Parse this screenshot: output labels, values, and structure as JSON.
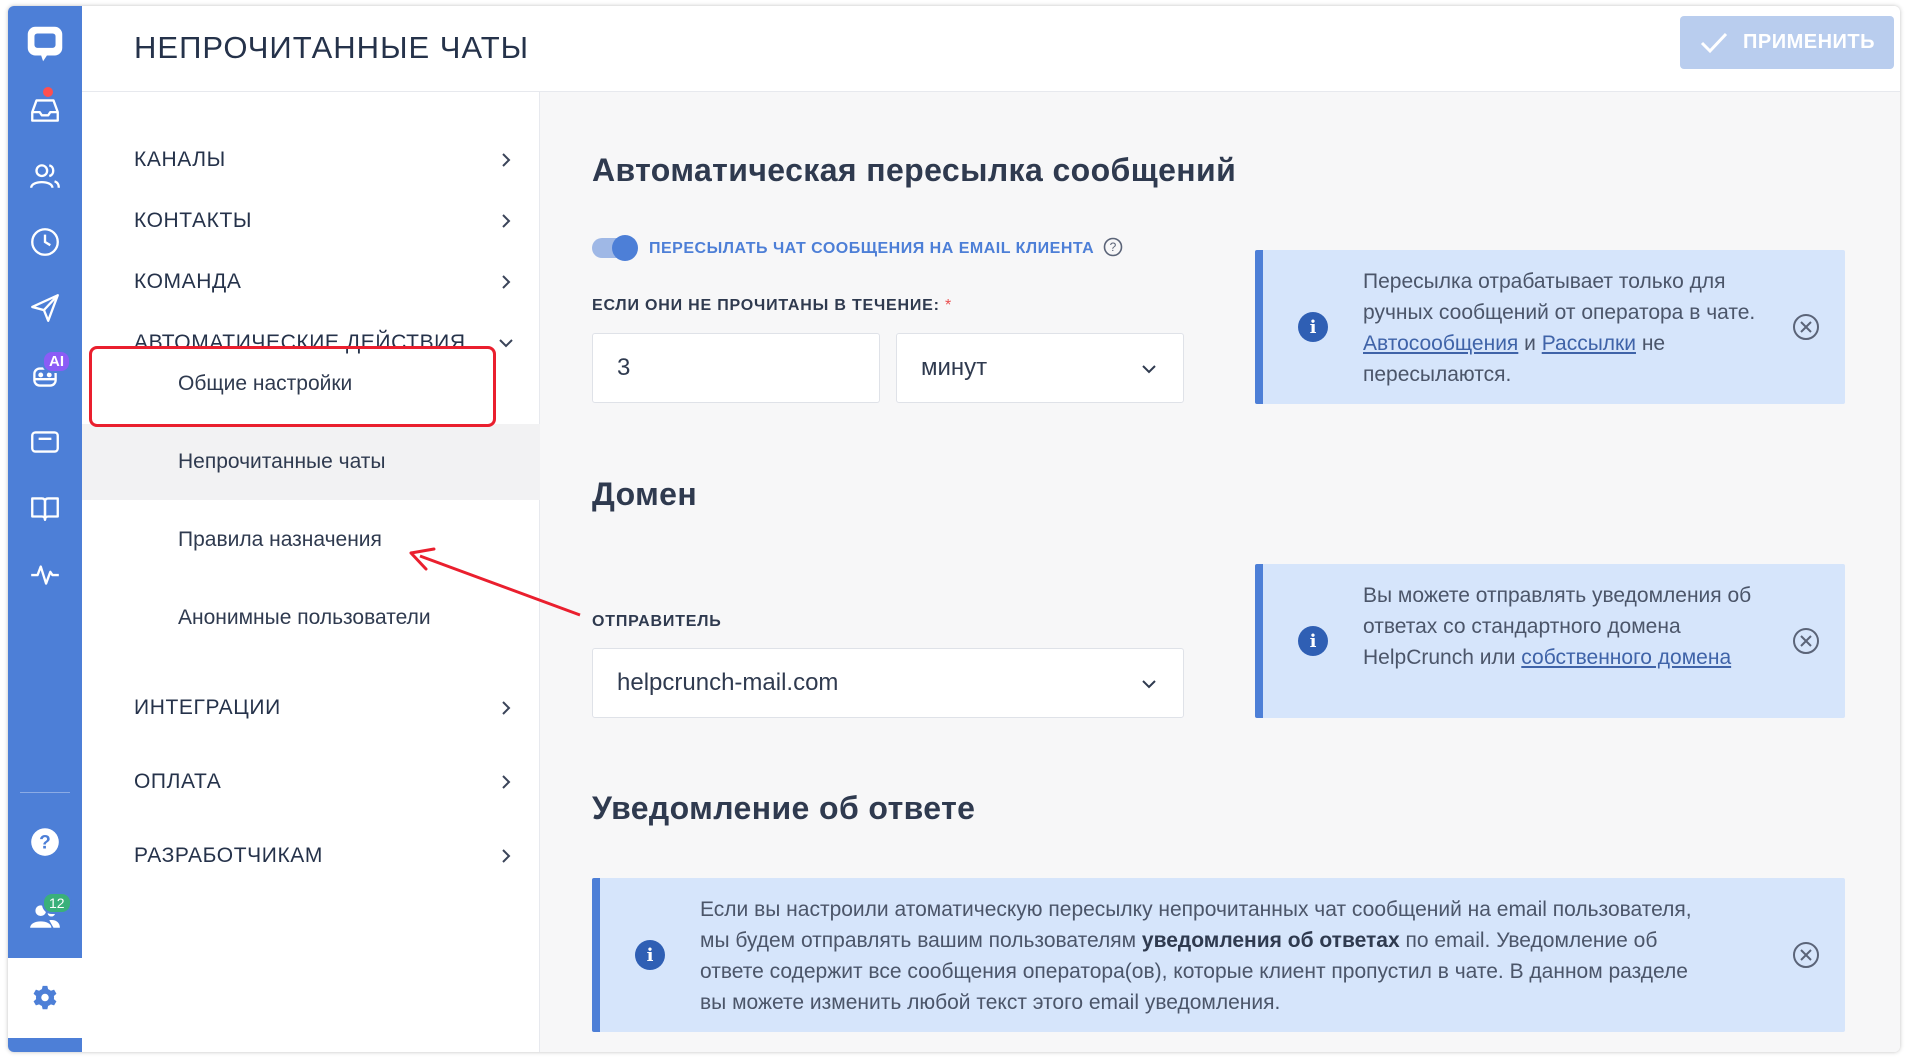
{
  "app": {
    "rail": {
      "items": [
        {
          "icon": "chat-logo-icon"
        },
        {
          "icon": "inbox-icon",
          "has_dot": true
        },
        {
          "icon": "contacts-icon"
        },
        {
          "icon": "clock-icon"
        },
        {
          "icon": "send-icon"
        },
        {
          "icon": "ai-bot-icon",
          "badge": "AI"
        },
        {
          "icon": "widget-icon"
        },
        {
          "icon": "knowledge-base-icon"
        },
        {
          "icon": "activity-icon"
        },
        {
          "icon": "help-icon"
        },
        {
          "icon": "team-icon",
          "badge": "12"
        },
        {
          "icon": "settings-icon",
          "active": true
        }
      ]
    },
    "colors": {
      "rail": "#4d7fd7",
      "accent": "#4d7fd7",
      "annotation": "#ea1f2e",
      "info_bg": "#d6e5fb"
    }
  },
  "header": {
    "title": "НЕПРОЧИТАННЫЕ ЧАТЫ",
    "apply_label": "ПРИМЕНИТЬ"
  },
  "nav": {
    "items": [
      {
        "label": "КАНАЛЫ"
      },
      {
        "label": "КОНТАКТЫ"
      },
      {
        "label": "КОМАНДА"
      },
      {
        "label": "АВТОМАТИЧЕСКИЕ ДЕЙСТВИЯ",
        "expanded": true
      },
      {
        "label": "ИНТЕГРАЦИИ"
      },
      {
        "label": "ОПЛАТА"
      },
      {
        "label": "РАЗРАБОТЧИКАМ"
      }
    ],
    "sub_items": [
      {
        "label": "Общие настройки"
      },
      {
        "label": "Непрочитанные чаты",
        "selected": true
      },
      {
        "label": "Правила назначения"
      },
      {
        "label": "Анонимные пользователи"
      }
    ]
  },
  "forwarding": {
    "title": "Автоматическая пересылка сообщений",
    "toggle_label": "ПЕРЕСЫЛАТЬ ЧАТ СООБЩЕНИЯ НА EMAIL КЛИЕНТА",
    "toggle_on": true,
    "delay_label": "ЕСЛИ ОНИ НЕ ПРОЧИТАНЫ В ТЕЧЕНИЕ:",
    "required_mark": "*",
    "delay_value": "3",
    "delay_unit": "минут",
    "info": {
      "part1": "Пересылка отрабатывает только для ручных сообщений от оператора в чате. ",
      "link1": "Автосообщения",
      "part2": " и ",
      "link2": "Рассылки",
      "part3": " не пересылаются."
    }
  },
  "domain": {
    "title": "Домен",
    "sender_label": "ОТПРАВИТЕЛЬ",
    "sender_value": "helpcrunch-mail.com",
    "info": {
      "part1": "Вы можете отправлять уведомления об ответах со стандартного домена HelpCrunch или ",
      "link1": "собственного домена"
    }
  },
  "reply_notification": {
    "title": "Уведомление об ответе",
    "info": {
      "part1": "Если вы настроили атоматическую пересылку непрочитанных чат сообщений на email пользователя, мы будем отправлять вашим пользователям ",
      "bold": "уведомления об ответах",
      "part2": " по email. Уведомление об ответе содержит все сообщения оператора(ов), которые клиент пропустил в чате. В данном разделе вы можете изменить любой текст этого email уведомления."
    }
  }
}
